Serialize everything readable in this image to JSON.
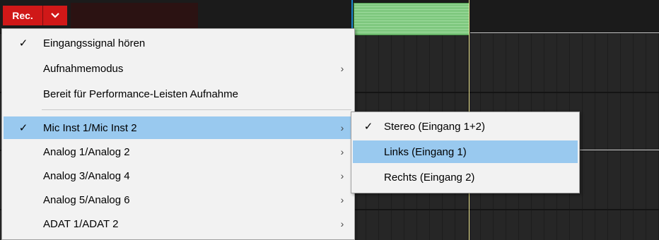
{
  "toolbar": {
    "rec_label": "Rec.",
    "dropdown_icon": "chevron-down-icon"
  },
  "main_menu": {
    "items": [
      {
        "label": "Eingangssignal hören",
        "checked": true,
        "submenu": false
      },
      {
        "label": "Aufnahmemodus",
        "checked": false,
        "submenu": true
      },
      {
        "label": "Bereit für Performance-Leisten Aufnahme",
        "checked": false,
        "submenu": false
      },
      {
        "label": "Mic Inst 1/Mic Inst 2",
        "checked": true,
        "submenu": true,
        "highlighted": true
      },
      {
        "label": "Analog 1/Analog 2",
        "checked": false,
        "submenu": true
      },
      {
        "label": "Analog 3/Analog 4",
        "checked": false,
        "submenu": true
      },
      {
        "label": "Analog 5/Analog 6",
        "checked": false,
        "submenu": true
      },
      {
        "label": "ADAT 1/ADAT 2",
        "checked": false,
        "submenu": true
      }
    ]
  },
  "sub_menu": {
    "items": [
      {
        "label": "Stereo (Eingang 1+2)",
        "checked": true
      },
      {
        "label": "Links (Eingang 1)",
        "checked": false,
        "highlighted": true
      },
      {
        "label": "Rechts (Eingang 2)",
        "checked": false
      }
    ]
  },
  "glyphs": {
    "check": "✓",
    "arrow": "›",
    "chevron": "⌄"
  },
  "colors": {
    "rec_red": "#d01818",
    "highlight": "#99c9ef",
    "clip_green": "#7fc87f",
    "playhead": "#e8e08a"
  }
}
